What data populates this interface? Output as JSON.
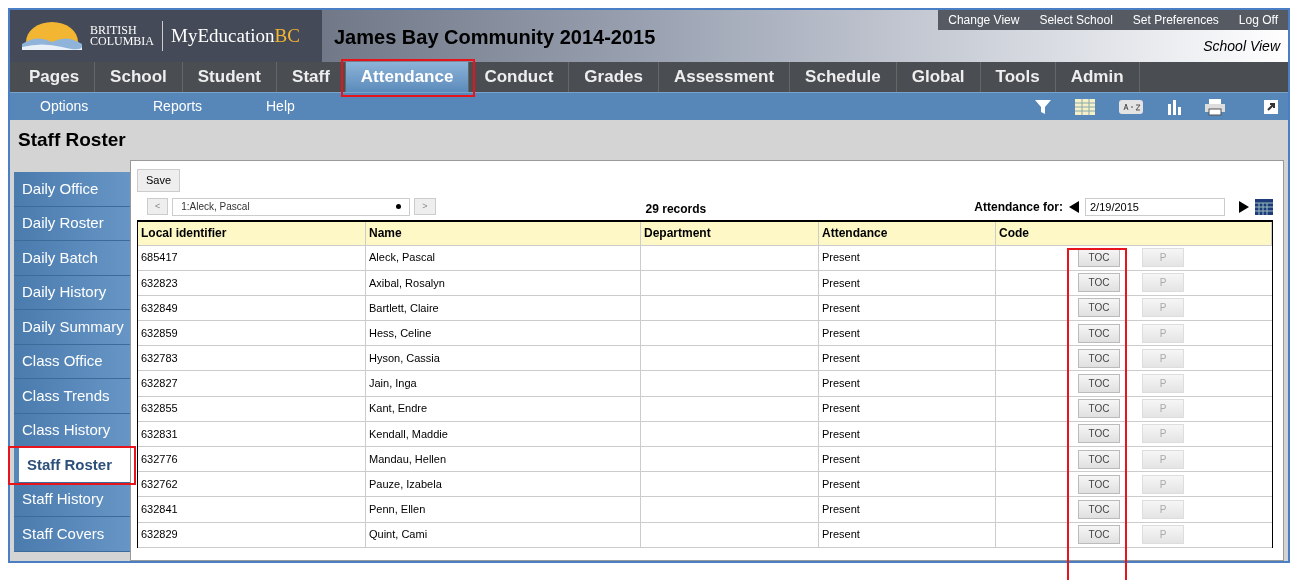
{
  "header": {
    "logo_top": "BRITISH",
    "logo_bottom": "COLUMBIA",
    "product": "MyEducation",
    "product_suffix": "BC",
    "school_title": "James Bay Community 2014-2015",
    "utility_links": [
      "Change View",
      "Select School",
      "Set Preferences",
      "Log Off"
    ],
    "view_label": "School View"
  },
  "tabs": [
    {
      "label": "Pages",
      "selected": false
    },
    {
      "label": "School",
      "selected": false
    },
    {
      "label": "Student",
      "selected": false
    },
    {
      "label": "Staff",
      "selected": false
    },
    {
      "label": "Attendance",
      "selected": true
    },
    {
      "label": "Conduct",
      "selected": false
    },
    {
      "label": "Grades",
      "selected": false
    },
    {
      "label": "Assessment",
      "selected": false
    },
    {
      "label": "Schedule",
      "selected": false
    },
    {
      "label": "Global",
      "selected": false
    },
    {
      "label": "Tools",
      "selected": false
    },
    {
      "label": "Admin",
      "selected": false
    }
  ],
  "menu": [
    "Options",
    "Reports",
    "Help"
  ],
  "page_title": "Staff Roster",
  "sidebar": {
    "items": [
      {
        "label": "Daily Office",
        "selected": false
      },
      {
        "label": "Daily Roster",
        "selected": false
      },
      {
        "label": "Daily Batch",
        "selected": false
      },
      {
        "label": "Daily History",
        "selected": false
      },
      {
        "label": "Daily Summary",
        "selected": false
      },
      {
        "label": "Class Office",
        "selected": false
      },
      {
        "label": "Class Trends",
        "selected": false
      },
      {
        "label": "Class History",
        "selected": false
      },
      {
        "label": "Staff Roster",
        "selected": true
      },
      {
        "label": "Staff History",
        "selected": false
      },
      {
        "label": "Staff Covers",
        "selected": false
      }
    ]
  },
  "toolbar": {
    "save": "Save",
    "prev": "<",
    "next": ">",
    "record_select": "1:Aleck, Pascal",
    "record_count": "29 records",
    "date_label": "Attendance for:",
    "date": "2/19/2015"
  },
  "table": {
    "columns": [
      "Local identifier",
      "Name",
      "Department",
      "Attendance",
      "Code"
    ],
    "rows": [
      {
        "id": "685417",
        "name": "Aleck, Pascal",
        "attendance": "Present",
        "toc": "TOC",
        "p": "P"
      },
      {
        "id": "632823",
        "name": "Axibal, Rosalyn",
        "attendance": "Present",
        "toc": "TOC",
        "p": "P"
      },
      {
        "id": "632849",
        "name": "Bartlett, Claire",
        "attendance": "Present",
        "toc": "TOC",
        "p": "P"
      },
      {
        "id": "632859",
        "name": "Hess, Celine",
        "attendance": "Present",
        "toc": "TOC",
        "p": "P"
      },
      {
        "id": "632783",
        "name": "Hyson, Cassia",
        "attendance": "Present",
        "toc": "TOC",
        "p": "P"
      },
      {
        "id": "632827",
        "name": "Jain, Inga",
        "attendance": "Present",
        "toc": "TOC",
        "p": "P"
      },
      {
        "id": "632855",
        "name": "Kant, Endre",
        "attendance": "Present",
        "toc": "TOC",
        "p": "P"
      },
      {
        "id": "632831",
        "name": "Kendall, Maddie",
        "attendance": "Present",
        "toc": "TOC",
        "p": "P"
      },
      {
        "id": "632776",
        "name": "Mandau, Hellen",
        "attendance": "Present",
        "toc": "TOC",
        "p": "P"
      },
      {
        "id": "632762",
        "name": "Pauze, Izabela",
        "attendance": "Present",
        "toc": "TOC",
        "p": "P"
      },
      {
        "id": "632841",
        "name": "Penn, Ellen",
        "attendance": "Present",
        "toc": "TOC",
        "p": "P"
      },
      {
        "id": "632829",
        "name": "Quint, Cami",
        "attendance": "Present",
        "toc": "TOC",
        "p": "P"
      }
    ]
  }
}
